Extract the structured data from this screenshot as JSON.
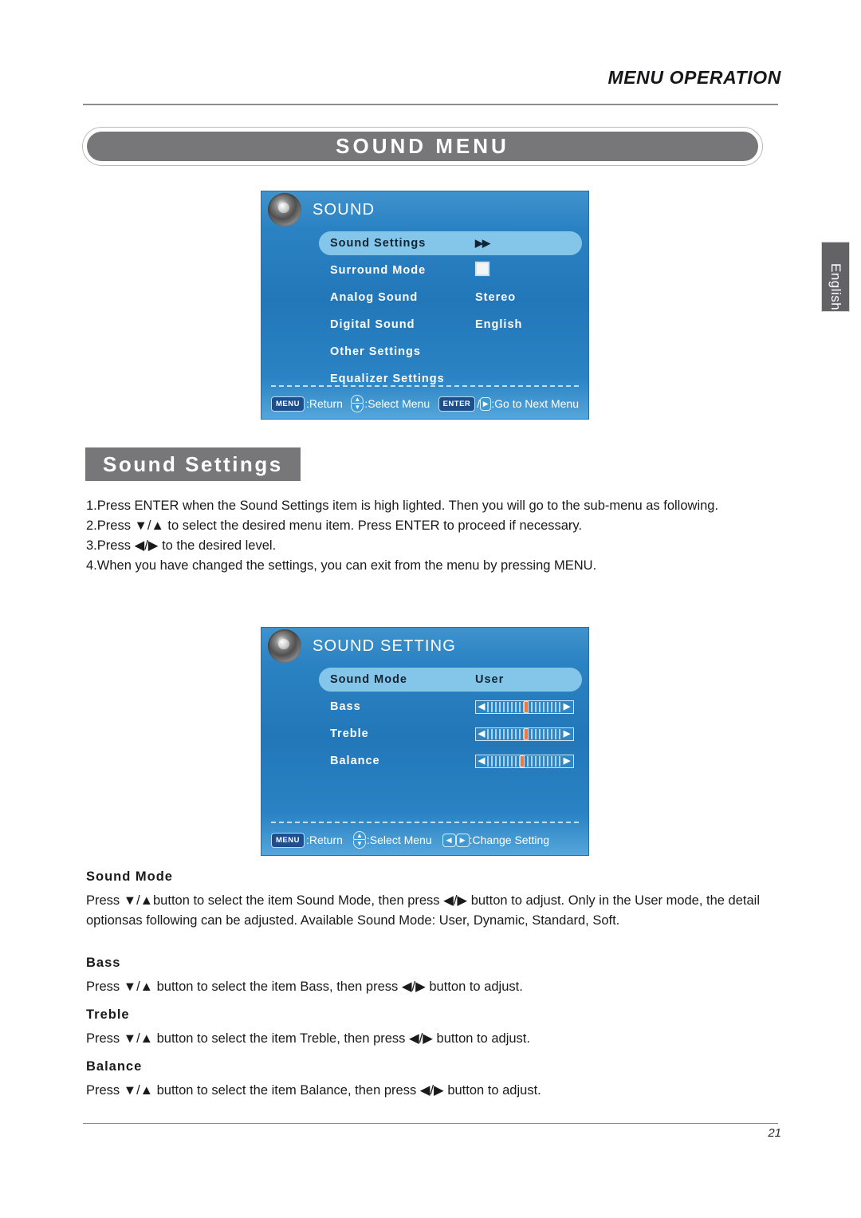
{
  "header": {
    "title": "MENU OPERATION"
  },
  "banner": {
    "label": "SOUND MENU"
  },
  "language_tab": {
    "label": "English"
  },
  "osd_sound": {
    "title": "SOUND",
    "icon": "speaker-icon",
    "rows": [
      {
        "label": "Sound Settings",
        "value": "▶▶",
        "type": "arrows",
        "highlight": true
      },
      {
        "label": "Surround Mode",
        "value": "",
        "type": "checkbox",
        "highlight": false
      },
      {
        "label": "Analog Sound",
        "value": "Stereo",
        "type": "text",
        "highlight": false
      },
      {
        "label": "Digital Sound",
        "value": "English",
        "type": "text",
        "highlight": false
      },
      {
        "label": "Other Settings",
        "value": "",
        "type": "text",
        "highlight": false
      },
      {
        "label": "Equalizer Settings",
        "value": "",
        "type": "text",
        "highlight": false
      }
    ],
    "hints": {
      "menu_key": "MENU",
      "menu_text": ":Return",
      "select_text": ":Select Menu",
      "enter_key": "ENTER",
      "enter_sep": "/",
      "enter_arrow": "▶",
      "enter_text": ":Go to Next Menu"
    }
  },
  "osd_sound_setting": {
    "title": "SOUND SETTING",
    "icon": "speaker-icon",
    "rows": [
      {
        "label": "Sound Mode",
        "value": "User",
        "type": "text",
        "highlight": true
      },
      {
        "label": "Bass",
        "value": 52,
        "type": "slider",
        "highlight": false
      },
      {
        "label": "Treble",
        "value": 52,
        "type": "slider",
        "highlight": false
      },
      {
        "label": "Balance",
        "value": 47,
        "type": "slider",
        "highlight": false
      }
    ],
    "hints": {
      "menu_key": "MENU",
      "menu_text": ":Return",
      "select_text": ":Select Menu",
      "left_arrow": "◀",
      "right_arrow": "▶",
      "change_text": ":Change Setting"
    }
  },
  "section_bar": {
    "label": "Sound Settings"
  },
  "steps": [
    {
      "num": "1.",
      "text": "Press ENTER when the Sound Settings item is high lighted. Then you will go to the sub-menu as following."
    },
    {
      "num": "2.",
      "text": "Press ▼/▲ to select the desired menu item. Press ENTER to proceed if necessary."
    },
    {
      "num": "3.",
      "text": "Press ◀/▶ to the desired level."
    },
    {
      "num": "4.",
      "text": "When you have changed the settings, you can exit from the menu by pressing MENU."
    }
  ],
  "sections": [
    {
      "heading": "Sound Mode",
      "body": "Press ▼/▲button to select the item Sound Mode, then press ◀/▶ button to adjust. Only in the User mode, the detail optionsas following can be adjusted. Available Sound Mode: User, Dynamic, Standard, Soft."
    },
    {
      "heading": "Bass",
      "body": "Press ▼/▲ button to select the item Bass, then press ◀/▶ button to adjust."
    },
    {
      "heading": "Treble",
      "body": "Press ▼/▲ button to select the item Treble, then press ◀/▶ button to adjust."
    },
    {
      "heading": "Balance",
      "body": "Press ▼/▲ button to select the item Balance, then press ◀/▶ button to adjust."
    }
  ],
  "footer": {
    "page_number": "21"
  }
}
